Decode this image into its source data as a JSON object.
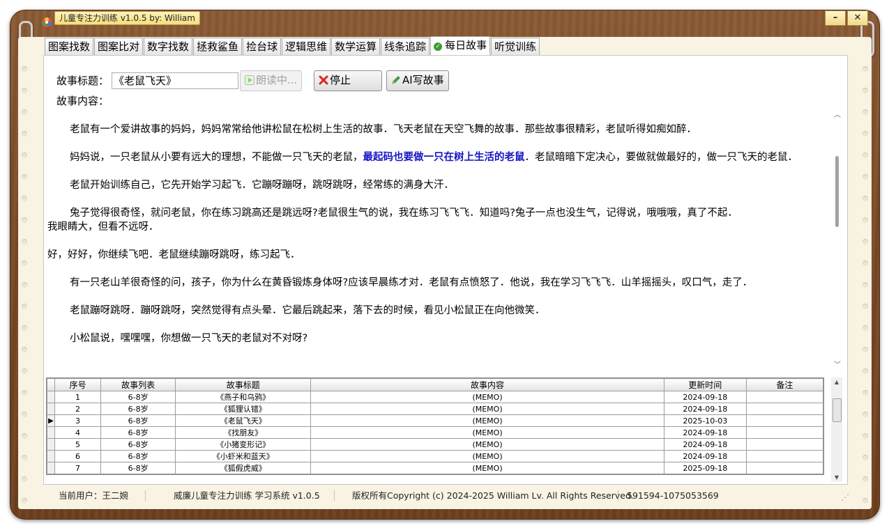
{
  "window": {
    "title": "儿童专注力训练 v1.0.5 by: William",
    "minimize": "–",
    "close": "✕"
  },
  "tabs": [
    {
      "label": "图案找数"
    },
    {
      "label": "图案比对"
    },
    {
      "label": "数字找数"
    },
    {
      "label": "拯救鲨鱼"
    },
    {
      "label": "捡台球"
    },
    {
      "label": "逻辑思维"
    },
    {
      "label": "数学运算"
    },
    {
      "label": "线条追踪"
    },
    {
      "label": "每日故事",
      "active": true
    },
    {
      "label": "听觉训练"
    }
  ],
  "story_panel": {
    "title_label": "故事标题：",
    "title_value": "《老鼠飞天》",
    "read_button": "朗读中...",
    "stop_button": "停止",
    "ai_button": "AI写故事",
    "content_label": "故事内容："
  },
  "story": {
    "p1": "老鼠有一个爱讲故事的妈妈，妈妈常常给他讲松鼠在松树上生活的故事．飞天老鼠在天空飞舞的故事．那些故事很精彩，老鼠听得如痴如醉．",
    "p2a": "妈妈说，一只老鼠从小要有远大的理想，不能做一只飞天的老鼠，",
    "p2b": "最起码也要做一只在树上生活的老鼠",
    "p2c": "．老鼠暗暗下定决心，要做就做最好的，做一只飞天的老鼠．",
    "p3": "老鼠开始训练自己，它先开始学习起飞．它蹦呀蹦呀，跳呀跳呀，经常练的满身大汗．",
    "p4a": "兔子觉得很奇怪，就问老鼠，你在练习跳高还是跳远呀?老鼠很生气的说，我在练习飞飞飞．知道吗?兔子一点也没生气，记得说，哦哦哦，真了不起．",
    "p4b": "我眼睛大，但看不远呀．",
    "p5": "好，好好，你继续飞吧．老鼠继续蹦呀跳呀，练习起飞．",
    "p6": "有一只老山羊很奇怪的问，孩子，你为什么在黄昏锻炼身体呀?应该早晨练才对．老鼠有点愤怒了．他说，我在学习飞飞飞．山羊摇摇头，叹口气，走了．",
    "p7": "老鼠蹦呀跳呀．蹦呀跳呀，突然觉得有点头晕．它最后跳起来，落下去的时候，看见小松鼠正在向他微笑．",
    "p8": "小松鼠说，嘿嘿嘿，你想做一只飞天的老鼠对不对呀?"
  },
  "table": {
    "headers": [
      "序号",
      "故事列表",
      "故事标题",
      "故事内容",
      "更新时间",
      "备注"
    ],
    "rows": [
      {
        "no": "1",
        "list": "6-8岁",
        "title": "《燕子和乌鸦》",
        "content": "(MEMO)",
        "time": "2024-09-18",
        "note": ""
      },
      {
        "no": "2",
        "list": "6-8岁",
        "title": "《狐狸认错》",
        "content": "(MEMO)",
        "time": "2024-09-18",
        "note": ""
      },
      {
        "no": "3",
        "list": "6-8岁",
        "title": "《老鼠飞天》",
        "content": "(MEMO)",
        "time": "2025-10-03",
        "note": ""
      },
      {
        "no": "4",
        "list": "6-8岁",
        "title": "《找朋友》",
        "content": "(MEMO)",
        "time": "2024-09-18",
        "note": ""
      },
      {
        "no": "5",
        "list": "6-8岁",
        "title": "《小猪变形记》",
        "content": "(MEMO)",
        "time": "2024-09-18",
        "note": ""
      },
      {
        "no": "6",
        "list": "6-8岁",
        "title": "《小虾米和蓝天》",
        "content": "(MEMO)",
        "time": "2024-09-18",
        "note": ""
      },
      {
        "no": "7",
        "list": "6-8岁",
        "title": "《狐假虎威》",
        "content": "(MEMO)",
        "time": "2025-09-18",
        "note": ""
      }
    ],
    "current_row_marker": "▶"
  },
  "status": {
    "user": "当前用户：王二婉",
    "system": "威廉儿童专注力训练 学习系统 v1.0.5",
    "copyright": "版权所有Copyright (c) 2024-2025 William Lv. All Rights Reserved.",
    "contact": "591594-1075053569"
  },
  "colors": {
    "wood": "#7a4a26",
    "paper": "#f8f3e3",
    "highlight": "#1515c4",
    "title_tag": "#f5dd7d"
  }
}
